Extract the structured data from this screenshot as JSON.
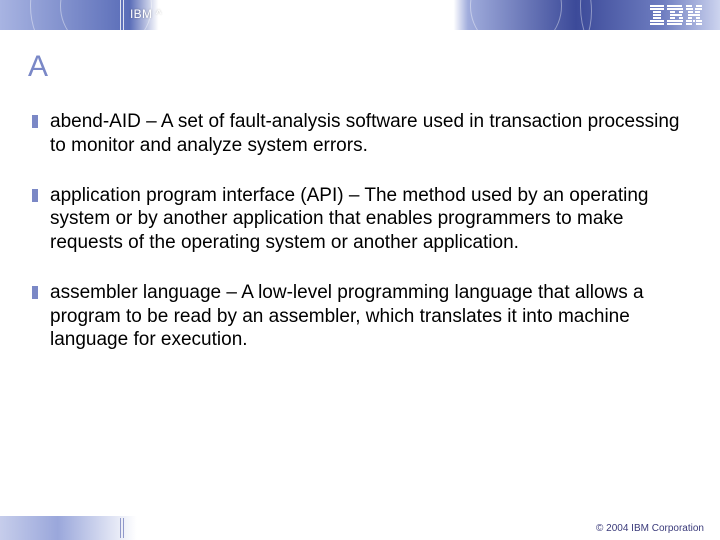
{
  "header": {
    "brand_text": "IBM ^",
    "logo_name": "ibm-logo"
  },
  "title": "A",
  "bullets": [
    "abend-AID – A set of fault-analysis software used in transaction processing to monitor and analyze system errors.",
    "application program interface (API) – The method used by an operating system or by another application that enables programmers to make requests of the operating system or another application.",
    "assembler language – A low-level programming language that allows a program to be read by an assembler, which translates it into machine language for execution."
  ],
  "footer": {
    "copyright": "© 2004 IBM Corporation"
  }
}
